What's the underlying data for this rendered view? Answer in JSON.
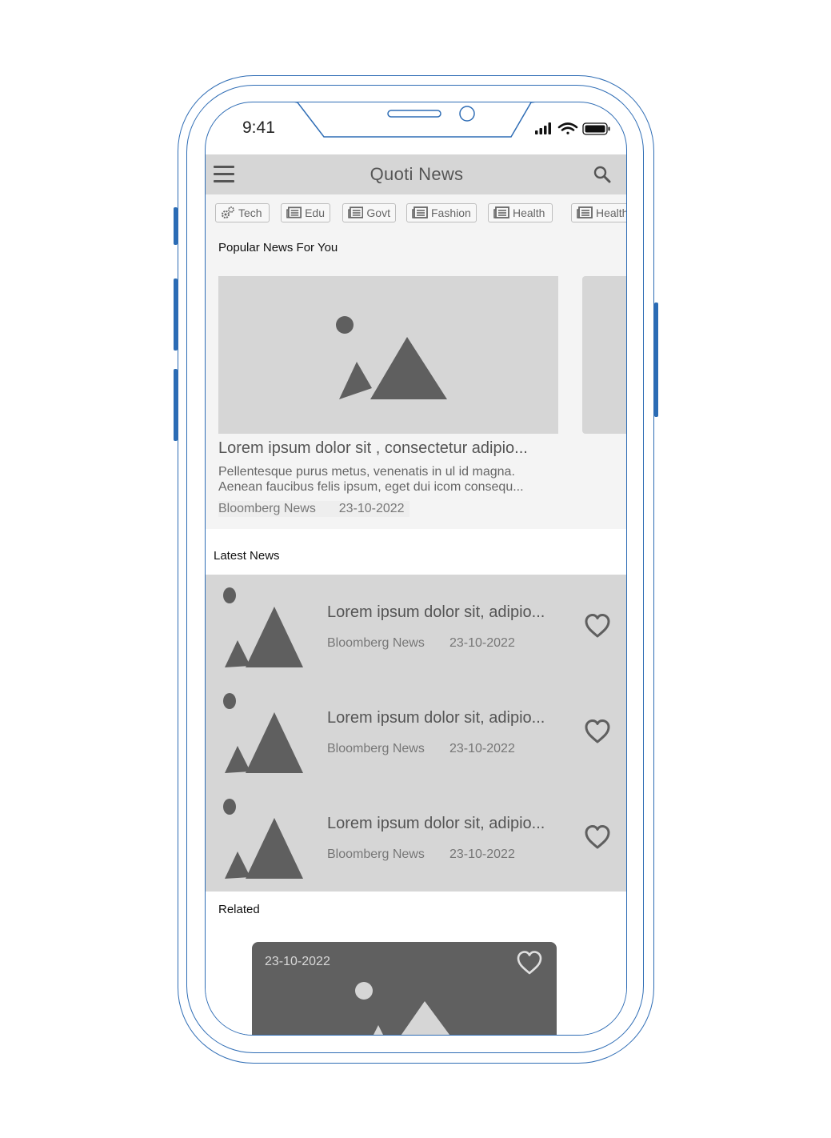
{
  "status_bar": {
    "time": "9:41"
  },
  "app_bar": {
    "title": "Quoti News"
  },
  "categories": [
    {
      "label": "Tech",
      "icon": "gear-icon"
    },
    {
      "label": "Edu",
      "icon": "newspaper-icon"
    },
    {
      "label": "Govt",
      "icon": "newspaper-icon"
    },
    {
      "label": "Fashion",
      "icon": "newspaper-icon"
    },
    {
      "label": "Health",
      "icon": "newspaper-icon"
    },
    {
      "label": "Health",
      "icon": "newspaper-icon"
    }
  ],
  "popular": {
    "section_title": "Popular News For You",
    "headline": "Lorem ipsum dolor sit , consectetur adipio...",
    "description_line1": "Pellentesque purus metus, venenatis in ul id magna.",
    "description_line2": "Aenean faucibus felis ipsum, eget  dui icom consequ...",
    "source": "Bloomberg News",
    "date": "23-10-2022"
  },
  "latest": {
    "section_title": "Latest News",
    "items": [
      {
        "headline": "Lorem ipsum dolor sit, adipio...",
        "source": "Bloomberg News",
        "date": "23-10-2022"
      },
      {
        "headline": "Lorem ipsum dolor sit, adipio...",
        "source": "Bloomberg News",
        "date": "23-10-2022"
      },
      {
        "headline": "Lorem ipsum dolor sit, adipio...",
        "source": "Bloomberg News",
        "date": "23-10-2022"
      }
    ]
  },
  "related": {
    "section_title": "Related",
    "card_date": "23-10-2022"
  },
  "colors": {
    "frame": "#2f6db5",
    "placeholder": "#d6d6d6",
    "icon_dark": "#5f5f5f",
    "card_dark": "#606060"
  }
}
